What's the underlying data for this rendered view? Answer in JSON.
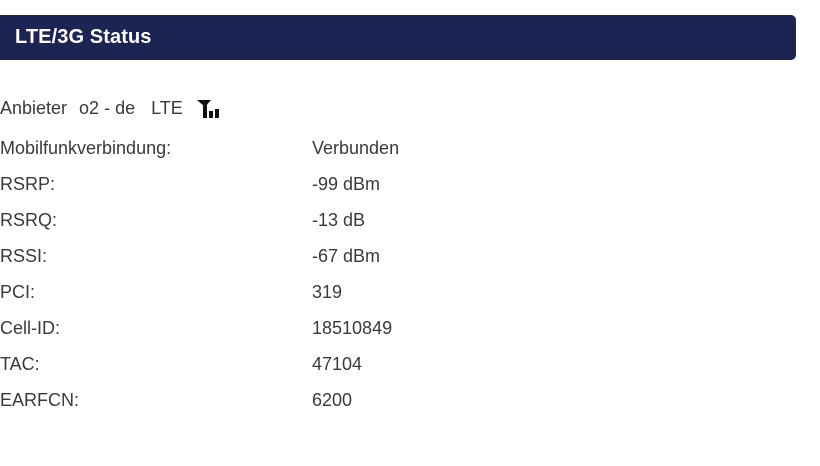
{
  "header": {
    "title": "LTE/3G Status"
  },
  "provider": {
    "label": "Anbieter",
    "name": "o2 - de",
    "technology": "LTE",
    "signal_icon": "signal-strength-icon"
  },
  "status": {
    "rows": [
      {
        "label": "Mobilfunkverbindung:",
        "value": "Verbunden"
      },
      {
        "label": "RSRP:",
        "value": "-99 dBm"
      },
      {
        "label": "RSRQ:",
        "value": "-13 dB"
      },
      {
        "label": "RSSI:",
        "value": "-67 dBm"
      },
      {
        "label": "PCI:",
        "value": "319"
      },
      {
        "label": "Cell-ID:",
        "value": "18510849"
      },
      {
        "label": "TAC:",
        "value": "47104"
      },
      {
        "label": "EARFCN:",
        "value": "6200"
      }
    ]
  },
  "colors": {
    "header_bg": "#1b2452",
    "header_text": "#ffffff",
    "body_text": "#3a3a3a"
  }
}
